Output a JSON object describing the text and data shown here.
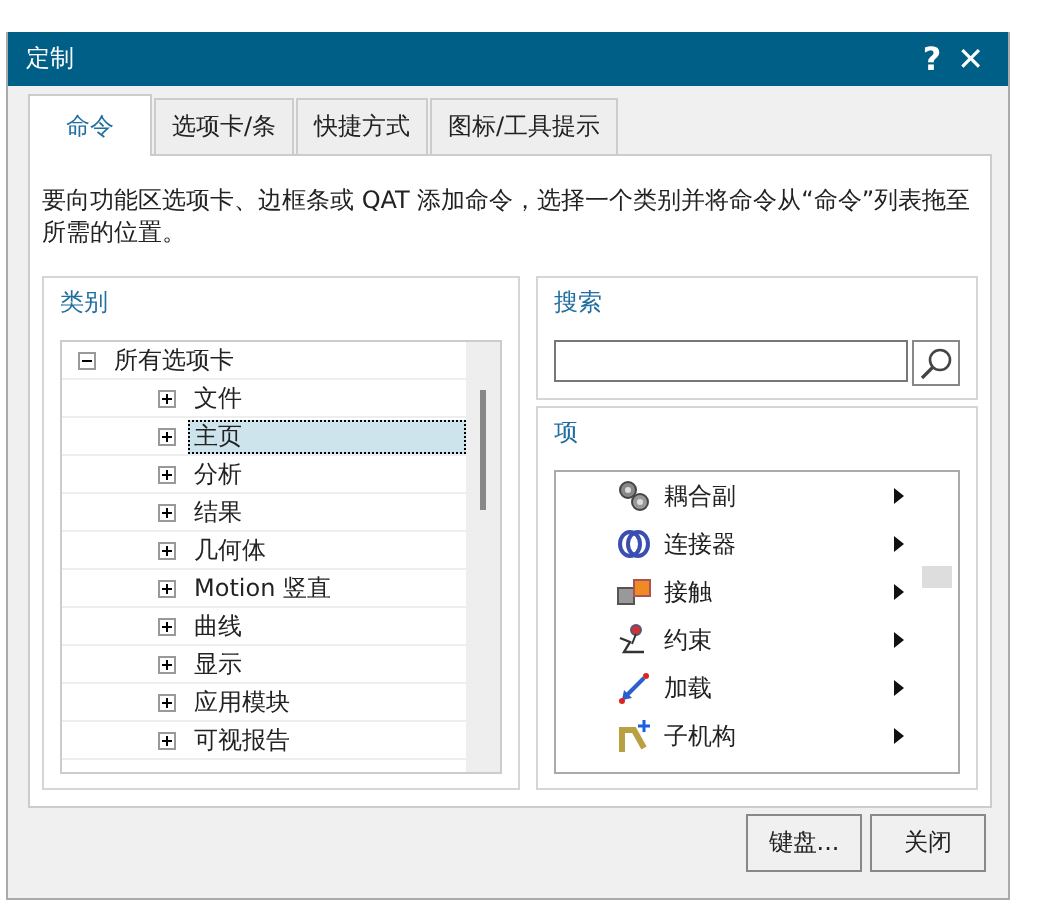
{
  "window": {
    "title": "定制",
    "help": "?",
    "close": "✕"
  },
  "tabs": [
    {
      "label": "命令",
      "selected": true
    },
    {
      "label": "选项卡/条",
      "selected": false
    },
    {
      "label": "快捷方式",
      "selected": false
    },
    {
      "label": "图标/工具提示",
      "selected": false
    }
  ],
  "description": "要向功能区选项卡、边框条或 QAT 添加命令，选择一个类别并将命令从“命令”列表拖至所需的位置。",
  "categories": {
    "title": "类别",
    "tree": [
      {
        "label": "所有选项卡",
        "expanded": true,
        "selected": false,
        "children": [
          {
            "label": "文件",
            "expanded": false,
            "selected": false
          },
          {
            "label": "主页",
            "expanded": false,
            "selected": true
          },
          {
            "label": "分析",
            "expanded": false,
            "selected": false
          },
          {
            "label": "结果",
            "expanded": false,
            "selected": false
          },
          {
            "label": "几何体",
            "expanded": false,
            "selected": false
          },
          {
            "label": "Motion 竖直",
            "expanded": false,
            "selected": false
          },
          {
            "label": "曲线",
            "expanded": false,
            "selected": false
          },
          {
            "label": "显示",
            "expanded": false,
            "selected": false
          },
          {
            "label": "应用模块",
            "expanded": false,
            "selected": false
          },
          {
            "label": "可视报告",
            "expanded": false,
            "selected": false
          }
        ]
      }
    ]
  },
  "search": {
    "title": "搜索"
  },
  "items": {
    "title": "项",
    "list": [
      {
        "label": "耦合副",
        "submenu": true
      },
      {
        "label": "连接器",
        "submenu": true
      },
      {
        "label": "接触",
        "submenu": true
      },
      {
        "label": "约束",
        "submenu": true
      },
      {
        "label": "加载",
        "submenu": true
      },
      {
        "label": "子机构",
        "submenu": true
      }
    ]
  },
  "buttons": [
    "键盘...",
    "关闭"
  ]
}
